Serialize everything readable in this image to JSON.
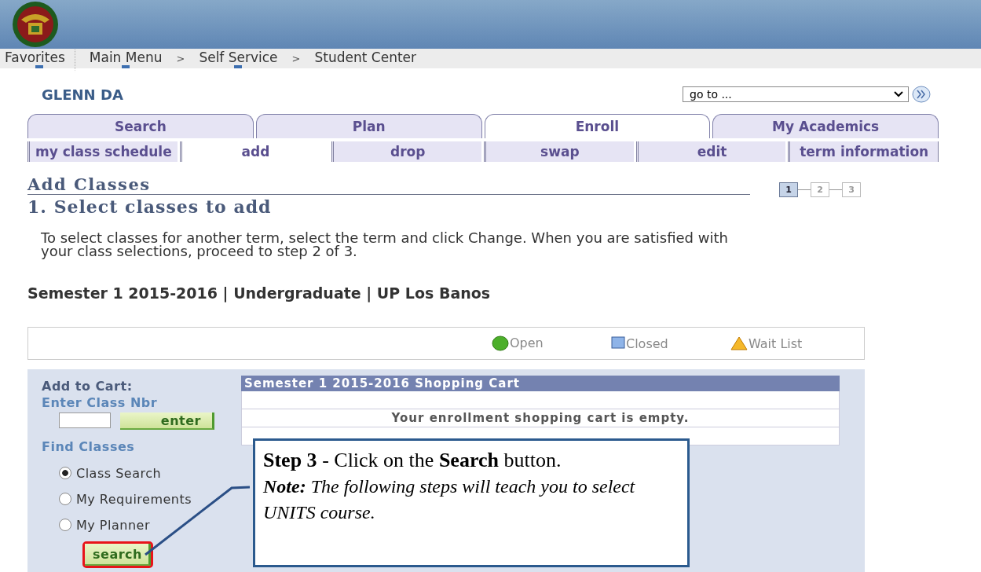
{
  "breadcrumb": [
    {
      "kind": "link",
      "label": "Favorites",
      "menu": true
    },
    {
      "kind": "link",
      "label": "Main Menu",
      "menu": true
    },
    {
      "kind": "separator",
      "label": ">"
    },
    {
      "kind": "link",
      "label": "Self Service",
      "menu": true
    },
    {
      "kind": "separator",
      "label": ">"
    },
    {
      "kind": "link",
      "label": "Student Center",
      "menu": false
    }
  ],
  "user_name": "GLENN DA",
  "goto": {
    "value": "go to ..."
  },
  "tabs": [
    {
      "label": "Search",
      "selected": false
    },
    {
      "label": "Plan",
      "selected": false
    },
    {
      "label": "Enroll",
      "selected": true
    },
    {
      "label": "My Academics",
      "selected": false
    }
  ],
  "subtabs": [
    {
      "label": "my class schedule",
      "selected": false
    },
    {
      "label": "add",
      "selected": true
    },
    {
      "label": "drop",
      "selected": false
    },
    {
      "label": "swap",
      "selected": false
    },
    {
      "label": "edit",
      "selected": false
    },
    {
      "label": "term information",
      "selected": false
    }
  ],
  "page_title": "Add Classes",
  "steps": [
    {
      "label": "1",
      "selected": true
    },
    {
      "label": "2",
      "selected": false
    },
    {
      "label": "3",
      "selected": false
    }
  ],
  "step_heading": "1.  Select classes to add",
  "instructions": "To select classes for another term, select the term and click Change.  When you are satisfied with your class selections, proceed to step 2 of 3.",
  "term": "Semester 1 2015-2016 | Undergraduate | UP Los Banos",
  "legend": [
    {
      "kind": "circle",
      "label": "Open",
      "color": "#4caf2a"
    },
    {
      "kind": "square",
      "label": "Closed",
      "color": "#8fb4e8"
    },
    {
      "kind": "triangle",
      "label": "Wait List",
      "color": "#f5b82a"
    }
  ],
  "add_to_cart": {
    "title": "Add to Cart:",
    "class_nbr_label": "Enter Class Nbr",
    "enter_button": "enter",
    "find_label": "Find Classes",
    "options": [
      {
        "label": "Class Search",
        "selected": true
      },
      {
        "label": "My Requirements",
        "selected": false
      },
      {
        "label": "My Planner",
        "selected": false
      }
    ],
    "search_button": "search",
    "search_highlighted": true
  },
  "cart": {
    "title": "Semester 1 2015-2016 Shopping Cart",
    "message": "Your enrollment shopping cart is empty."
  },
  "callout": {
    "title": "**Step 3** - Click on the **Search** button.",
    "note": "**Note:** The following steps will teach you to select UNITS course."
  }
}
